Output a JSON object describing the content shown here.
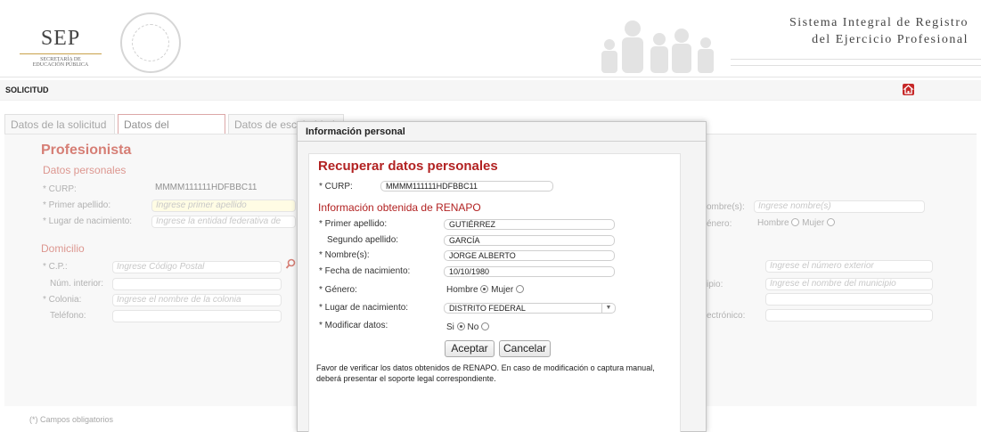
{
  "header": {
    "sep_word": "SEP",
    "sep_line1": "SECRETARÍA DE",
    "sep_line2": "EDUCACIÓN PÚBLICA",
    "system_title_line1": "Sistema Integral de Registro",
    "system_title_line2": "del Ejercicio Profesional"
  },
  "solicitud_bar": {
    "label": "SOLICITUD",
    "home_icon": "home-icon"
  },
  "tabs": [
    {
      "label": "Datos de la solicitud",
      "active": false
    },
    {
      "label": "Datos del solicitante",
      "active": true
    },
    {
      "label": "Datos de escolaridad",
      "active": false
    }
  ],
  "form": {
    "section_title": "Profesionista",
    "personal_title": "Datos personales",
    "curp_label": "* CURP:",
    "curp_value": "MMMM111111HDFBBC11",
    "primer_apellido_label": "* Primer apellido:",
    "primer_apellido_placeholder": "Ingrese primer apellido",
    "lugar_label": "* Lugar de nacimiento:",
    "lugar_placeholder": "Ingrese la entidad federativa de",
    "nombres_label": "ombre(s):",
    "nombres_placeholder": "Ingrese nombre(s)",
    "genero_label": "énero:",
    "genero_hombre": "Hombre",
    "genero_mujer": "Mujer",
    "domicilio_title": "Domicilio",
    "cp_label": "* C.P.:",
    "cp_placeholder": "Ingrese Código Postal",
    "num_interior_label": "Núm. interior:",
    "colonia_label": "* Colonia:",
    "colonia_placeholder": "Ingrese el nombre de la colonia",
    "telefono_label": "Teléfono:",
    "num_exterior_placeholder": "Ingrese el número exterior",
    "municipio_label": "ipio:",
    "municipio_placeholder": "Ingrese el nombre del municipio",
    "correo_label": "ectrónico:",
    "footnote": "(*) Campos obligatorios"
  },
  "modal": {
    "title": "Información personal",
    "heading": "Recuperar datos personales",
    "curp_label": "* CURP:",
    "curp_value": "MMMM111111HDFBBC11",
    "renapo_title": "Información obtenida de RENAPO",
    "fields": [
      {
        "label": "* Primer apellido:",
        "value": "GUTIÉRREZ"
      },
      {
        "label": "Segundo apellido:",
        "value": "GARCÍA"
      },
      {
        "label": "* Nombre(s):",
        "value": "JORGE ALBERTO"
      },
      {
        "label": "* Fecha de nacimiento:",
        "value": "10/10/1980"
      }
    ],
    "genero_label": "* Género:",
    "genero_hombre": "Hombre",
    "genero_mujer": "Mujer",
    "genero_selected": "Hombre",
    "lugar_label": "* Lugar de nacimiento:",
    "lugar_value": "DISTRITO FEDERAL",
    "modificar_label": "* Modificar datos:",
    "modificar_si": "Si",
    "modificar_no": "No",
    "modificar_selected": "Si",
    "accept_label": "Aceptar",
    "cancel_label": "Cancelar",
    "notice": "Favor de verificar los datos obtenidos de RENAPO. En caso de modificación o captura manual, deberá presentar el soporte legal correspondiente."
  }
}
